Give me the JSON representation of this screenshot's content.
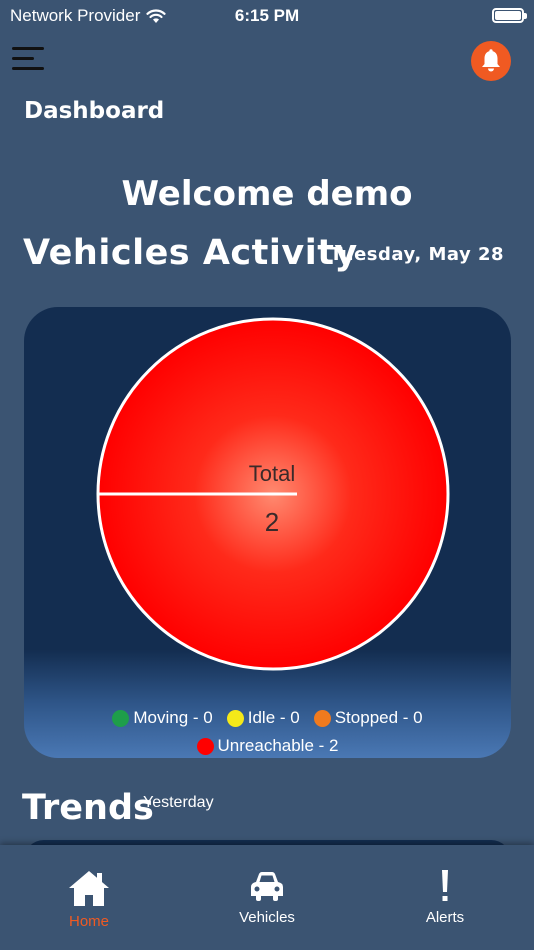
{
  "status_bar": {
    "carrier": "Network Provider",
    "time": "6:15 PM"
  },
  "header": {
    "title": "Dashboard"
  },
  "welcome": "Welcome demo",
  "activity": {
    "title": "Vehicles Activity",
    "date": "Tuesday, May 28"
  },
  "chart_data": {
    "type": "pie",
    "center_label": "Total",
    "total": "2",
    "slices": [
      {
        "name": "Moving",
        "value": 0,
        "color": "#1e9e4a"
      },
      {
        "name": "Idle",
        "value": 0,
        "color": "#f5e919"
      },
      {
        "name": "Stopped",
        "value": 0,
        "color": "#f07a1e"
      },
      {
        "name": "Unreachable",
        "value": 2,
        "color": "#ff0000"
      }
    ],
    "legend": {
      "moving": "Moving - 0",
      "idle": "Idle - 0",
      "stopped": "Stopped - 0",
      "unreachable": "Unreachable - 2"
    },
    "legend_position": "bottom"
  },
  "trends": {
    "title": "Trends",
    "subtitle": "Yesterday"
  },
  "tabs": [
    {
      "label": "Home",
      "icon": "home-icon"
    },
    {
      "label": "Vehicles",
      "icon": "car-icon"
    },
    {
      "label": "Alerts",
      "icon": "alert-icon"
    }
  ],
  "colors": {
    "accent": "#f05a22",
    "background": "#3b5472",
    "card": "#132d50"
  }
}
